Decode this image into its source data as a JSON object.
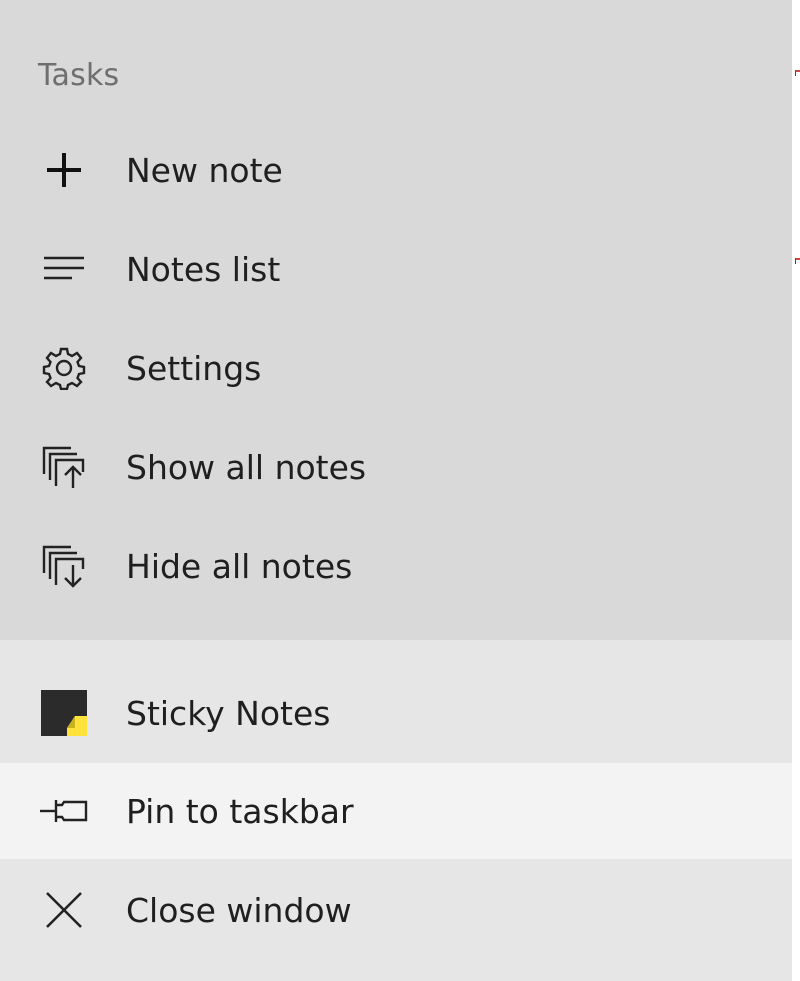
{
  "jumplist": {
    "section_title": "Tasks",
    "tasks": [
      {
        "label": "New note",
        "icon": "plus-icon"
      },
      {
        "label": "Notes list",
        "icon": "list-icon"
      },
      {
        "label": "Settings",
        "icon": "gear-icon"
      },
      {
        "label": "Show all notes",
        "icon": "show-notes-icon"
      },
      {
        "label": "Hide all notes",
        "icon": "hide-notes-icon"
      }
    ],
    "app": {
      "label": "Sticky Notes",
      "icon": "sticky-notes-app-icon"
    },
    "pin": {
      "label": "Pin to taskbar",
      "icon": "pin-icon"
    },
    "close": {
      "label": "Close window",
      "icon": "close-icon"
    }
  },
  "colors": {
    "tasks_bg": "#d9d9d9",
    "app_section_bg": "#e6e6e6",
    "hover_bg": "#f3f3f3",
    "sticky_yellow": "#ffe23a",
    "sticky_dark": "#2b2b2b"
  }
}
